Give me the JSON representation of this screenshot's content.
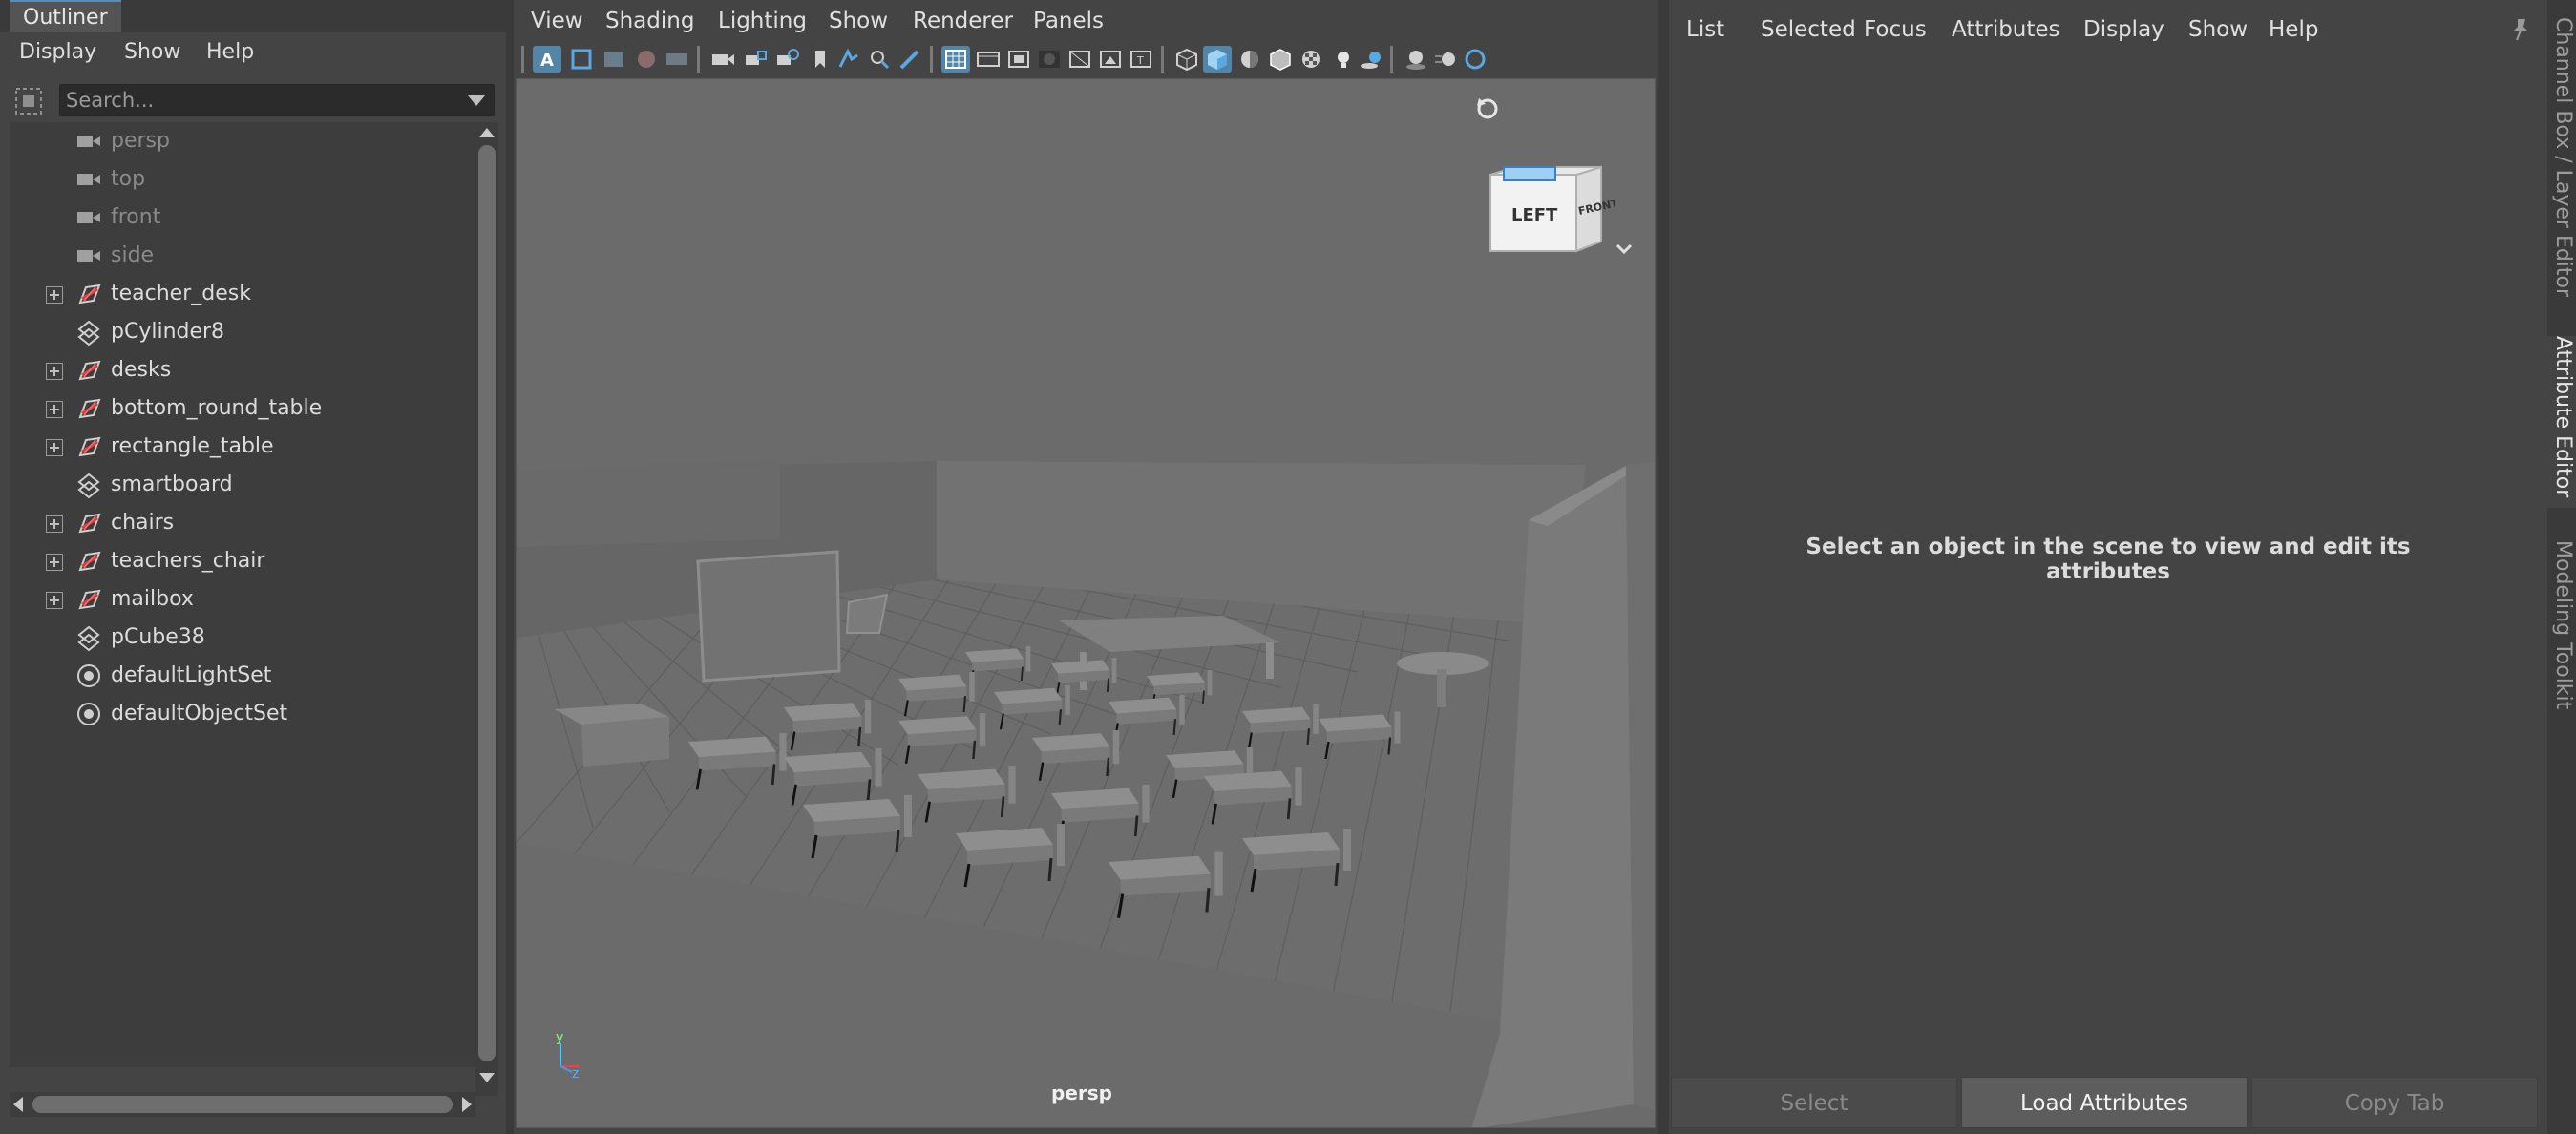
{
  "outliner": {
    "tab_title": "Outliner",
    "menus": [
      "Display",
      "Show",
      "Help"
    ],
    "search_placeholder": "Search...",
    "items": [
      {
        "label": "persp",
        "icon": "camera-icon",
        "expandable": false,
        "dim": true
      },
      {
        "label": "top",
        "icon": "camera-icon",
        "expandable": false,
        "dim": true
      },
      {
        "label": "front",
        "icon": "camera-icon",
        "expandable": false,
        "dim": true
      },
      {
        "label": "side",
        "icon": "camera-icon",
        "expandable": false,
        "dim": true
      },
      {
        "label": "teacher_desk",
        "icon": "group-transform-icon",
        "expandable": true,
        "dim": false
      },
      {
        "label": "pCylinder8",
        "icon": "mesh-transform-icon",
        "expandable": false,
        "dim": false
      },
      {
        "label": "desks",
        "icon": "group-transform-icon",
        "expandable": true,
        "dim": false
      },
      {
        "label": "bottom_round_table",
        "icon": "group-transform-icon",
        "expandable": true,
        "dim": false
      },
      {
        "label": "rectangle_table",
        "icon": "group-transform-icon",
        "expandable": true,
        "dim": false
      },
      {
        "label": "smartboard",
        "icon": "mesh-transform-icon",
        "expandable": false,
        "dim": false
      },
      {
        "label": "chairs",
        "icon": "group-transform-icon",
        "expandable": true,
        "dim": false
      },
      {
        "label": "teachers_chair",
        "icon": "group-transform-icon",
        "expandable": true,
        "dim": false
      },
      {
        "label": "mailbox",
        "icon": "group-transform-icon",
        "expandable": true,
        "dim": false
      },
      {
        "label": "pCube38",
        "icon": "mesh-transform-icon",
        "expandable": false,
        "dim": false
      },
      {
        "label": "defaultLightSet",
        "icon": "set-icon",
        "expandable": false,
        "dim": false
      },
      {
        "label": "defaultObjectSet",
        "icon": "set-icon",
        "expandable": false,
        "dim": false
      }
    ]
  },
  "viewport": {
    "menus": [
      "View",
      "Shading",
      "Lighting",
      "Show",
      "Renderer",
      "Panels"
    ],
    "camera_label": "persp",
    "viewcube": {
      "left_face": "LEFT",
      "front_face": "FRONT"
    },
    "axis": {
      "y": "y",
      "z": "z"
    },
    "accent_color": "#5285a6"
  },
  "attribute_editor": {
    "menus": [
      "List",
      "Selected",
      "Focus",
      "Attributes",
      "Display",
      "Show",
      "Help"
    ],
    "message": "Select an object in the scene to view and edit its attributes",
    "buttons": {
      "select": "Select",
      "load_attributes": "Load Attributes",
      "copy_tab": "Copy Tab"
    }
  },
  "side_tabs": {
    "channel_box": "Channel Box / Layer Editor",
    "attribute_editor": "Attribute Editor",
    "modeling_toolkit": "Modeling Toolkit"
  }
}
